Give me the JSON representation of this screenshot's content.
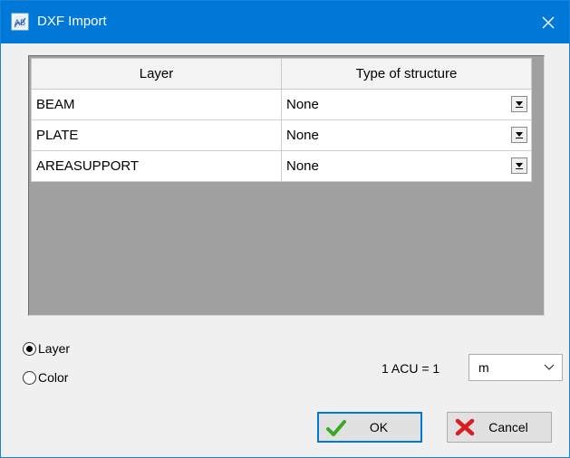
{
  "window": {
    "title": "DXF Import",
    "app_icon": "dxf-import-icon",
    "close_icon": "close-icon"
  },
  "grid": {
    "headers": {
      "layer": "Layer",
      "type": "Type of structure"
    },
    "rows": [
      {
        "layer": "BEAM",
        "type": "None"
      },
      {
        "layer": "PLATE",
        "type": "None"
      },
      {
        "layer": "AREASUPPORT",
        "type": "None"
      }
    ]
  },
  "options": {
    "layer_label": "Layer",
    "color_label": "Color",
    "selected": "Layer"
  },
  "units": {
    "label": "1 ACU = 1",
    "selected": "m"
  },
  "buttons": {
    "ok": "OK",
    "cancel": "Cancel"
  },
  "colors": {
    "titlebar": "#0078d7",
    "grid_background": "#a0a0a0",
    "ok_icon": "#3aa827",
    "cancel_icon": "#d81e1e"
  }
}
